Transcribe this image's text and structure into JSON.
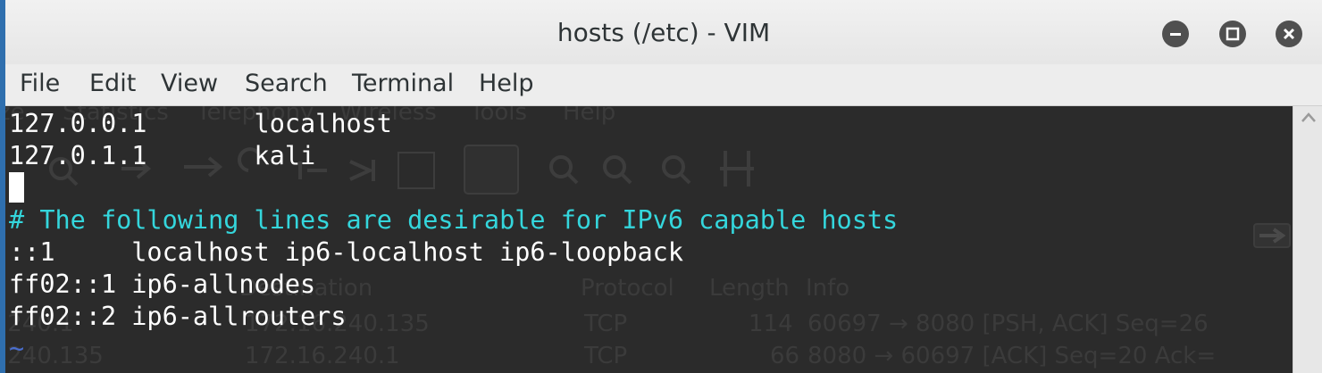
{
  "window": {
    "title": "hosts (/etc) - VIM",
    "controls": [
      "minimize-icon",
      "maximize-icon",
      "close-icon"
    ]
  },
  "menu": [
    "File",
    "Edit",
    "View",
    "Search",
    "Terminal",
    "Help"
  ],
  "editor": {
    "lines": [
      "127.0.0.1       localhost",
      "127.0.1.1       kali",
      "",
      "# The following lines are desirable for IPv6 capable hosts",
      "::1     localhost ip6-localhost ip6-loopback",
      "ff02::1 ip6-allnodes",
      "ff02::2 ip6-allrouters",
      "~"
    ]
  },
  "background_app": {
    "menu": [
      "ze",
      "Statistics",
      "Telephony",
      "Wireless",
      "Tools",
      "Help"
    ],
    "columns": [
      "Destination",
      "Protocol",
      "Length",
      "Info"
    ],
    "rows": [
      {
        "source": ".240.1",
        "destination": "172.16.240.135",
        "protocol": "TCP",
        "length": "114",
        "info": "60697 → 8080 [PSH, ACK] Seq=26"
      },
      {
        "source": ".240.135",
        "destination": "172.16.240.1",
        "protocol": "TCP",
        "length": "66",
        "info": "8080 → 60697 [ACK] Seq=20 Ack="
      }
    ]
  },
  "colors": {
    "terminal_bg": "#2b2b2b",
    "text": "#ffffff",
    "comment": "#34d6dc",
    "tilde": "#4a6fd0"
  }
}
